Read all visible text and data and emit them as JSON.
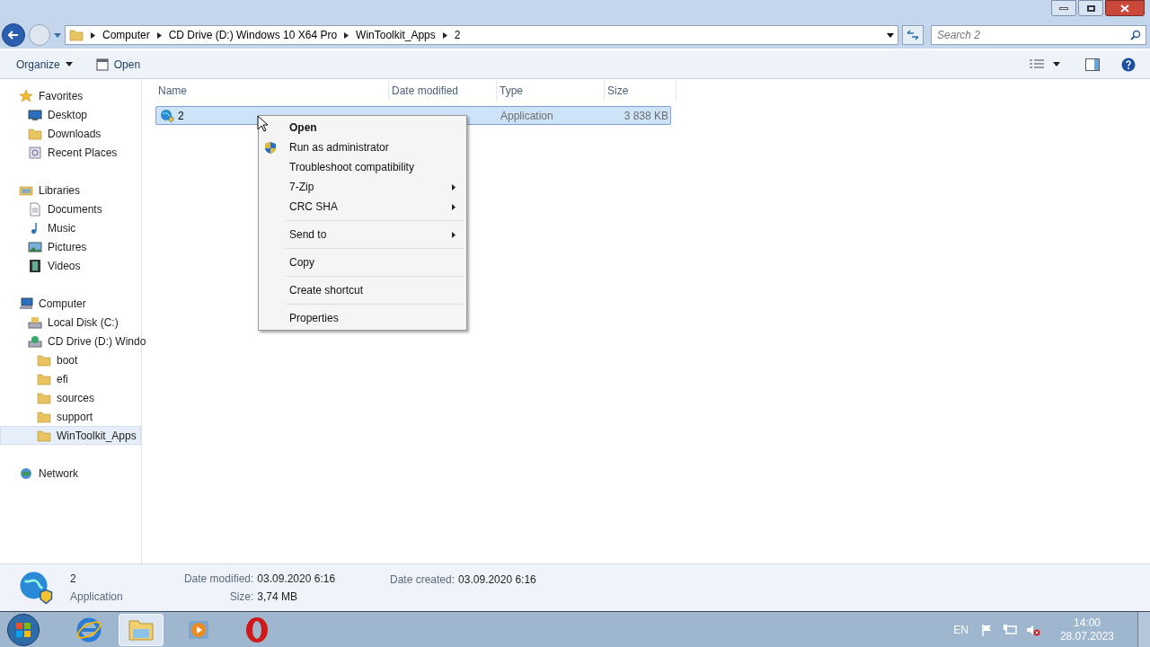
{
  "address": {
    "crumbs": [
      "Computer",
      "CD Drive (D:) Windows 10 X64 Pro",
      "WinToolkit_Apps",
      "2"
    ]
  },
  "search": {
    "placeholder": "Search 2"
  },
  "toolbar": {
    "buttons": [
      "Organize",
      "Open"
    ]
  },
  "sidebar": {
    "groups": [
      {
        "label": "Favorites",
        "kind": "star",
        "selected": false,
        "children": [
          {
            "label": "Desktop",
            "kind": "desktop",
            "selected": false
          },
          {
            "label": "Downloads",
            "kind": "folder",
            "selected": false
          },
          {
            "label": "Recent Places",
            "kind": "recent",
            "selected": false
          }
        ]
      },
      {
        "label": "Libraries",
        "kind": "library",
        "selected": false,
        "children": [
          {
            "label": "Documents",
            "kind": "document",
            "selected": false
          },
          {
            "label": "Music",
            "kind": "music",
            "selected": false
          },
          {
            "label": "Pictures",
            "kind": "pictures",
            "selected": false
          },
          {
            "label": "Videos",
            "kind": "video",
            "selected": false
          }
        ]
      },
      {
        "label": "Computer",
        "kind": "computer",
        "selected": false,
        "children": [
          {
            "label": "Local Disk (C:)",
            "kind": "disk",
            "selected": false
          },
          {
            "label": "CD Drive (D:) Windo",
            "kind": "cd",
            "selected": false,
            "children": [
              {
                "label": "boot",
                "kind": "folder",
                "selected": false
              },
              {
                "label": "efi",
                "kind": "folder",
                "selected": false
              },
              {
                "label": "sources",
                "kind": "folder",
                "selected": false
              },
              {
                "label": "support",
                "kind": "folder",
                "selected": false
              },
              {
                "label": "WinToolkit_Apps",
                "kind": "folder",
                "selected": true
              }
            ]
          }
        ]
      },
      {
        "label": "Network",
        "kind": "network",
        "selected": false
      }
    ]
  },
  "table": {
    "columns": [
      "Name",
      "Date modified",
      "Type",
      "Size"
    ],
    "rows": [
      {
        "name": "2",
        "type": "Application",
        "size": "3 838 KB",
        "selected": true
      }
    ]
  },
  "context_menu": {
    "items": [
      {
        "label": "Open",
        "default": true,
        "shield": false,
        "submenu": false,
        "separator_before": false
      },
      {
        "label": "Run as administrator",
        "default": false,
        "shield": true,
        "submenu": false,
        "separator_before": false
      },
      {
        "label": "Troubleshoot compatibility",
        "default": false,
        "shield": false,
        "submenu": false,
        "separator_before": false
      },
      {
        "label": "7-Zip",
        "default": false,
        "shield": false,
        "submenu": true,
        "separator_before": false
      },
      {
        "label": "CRC SHA",
        "default": false,
        "shield": false,
        "submenu": true,
        "separator_before": false
      },
      {
        "label": "Send to",
        "default": false,
        "shield": false,
        "submenu": true,
        "separator_before": true
      },
      {
        "label": "Copy",
        "default": false,
        "shield": false,
        "submenu": false,
        "separator_before": true
      },
      {
        "label": "Create shortcut",
        "default": false,
        "shield": false,
        "submenu": false,
        "separator_before": true
      },
      {
        "label": "Properties",
        "default": false,
        "shield": false,
        "submenu": false,
        "separator_before": true
      }
    ]
  },
  "details": {
    "name": "2",
    "type": "Application",
    "fields": [
      {
        "label": "Date modified:",
        "value": "03.09.2020 6:16"
      },
      {
        "label": "Size:",
        "value": "3,74 MB"
      },
      {
        "label": "Date created:",
        "value": "03.09.2020 6:16"
      }
    ]
  },
  "tray": {
    "language": "EN",
    "time": "14:00",
    "date": "28.07.2023"
  }
}
